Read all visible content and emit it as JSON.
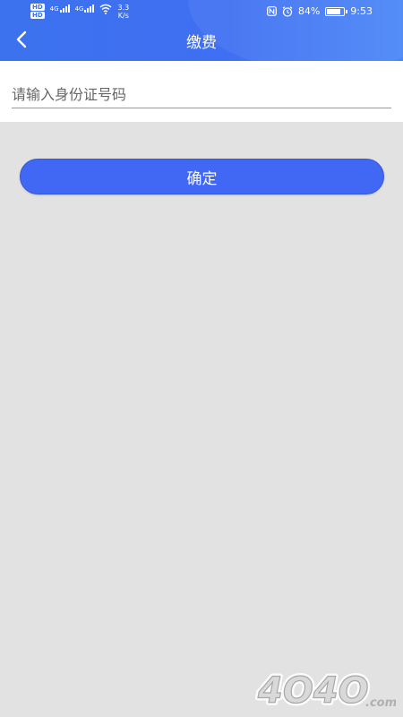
{
  "status_bar": {
    "network_label_1": "4G",
    "network_label_2": "4G",
    "hd_1": "HD",
    "hd_2": "HD",
    "speed_value": "3.3",
    "speed_unit": "K/s",
    "battery": "84%",
    "battery_level": 0.84,
    "time": "9:53"
  },
  "header": {
    "title": "缴费",
    "back_icon": "chevron-left-icon"
  },
  "form": {
    "id_number_placeholder": "请输入身份证号码",
    "id_number_value": ""
  },
  "actions": {
    "confirm_label": "确定"
  },
  "watermark": {
    "text": "4O4O",
    "suffix": ".com"
  },
  "colors": {
    "header": "#3f6ff2",
    "button": "#4167f5",
    "background": "#e2e2e2"
  }
}
